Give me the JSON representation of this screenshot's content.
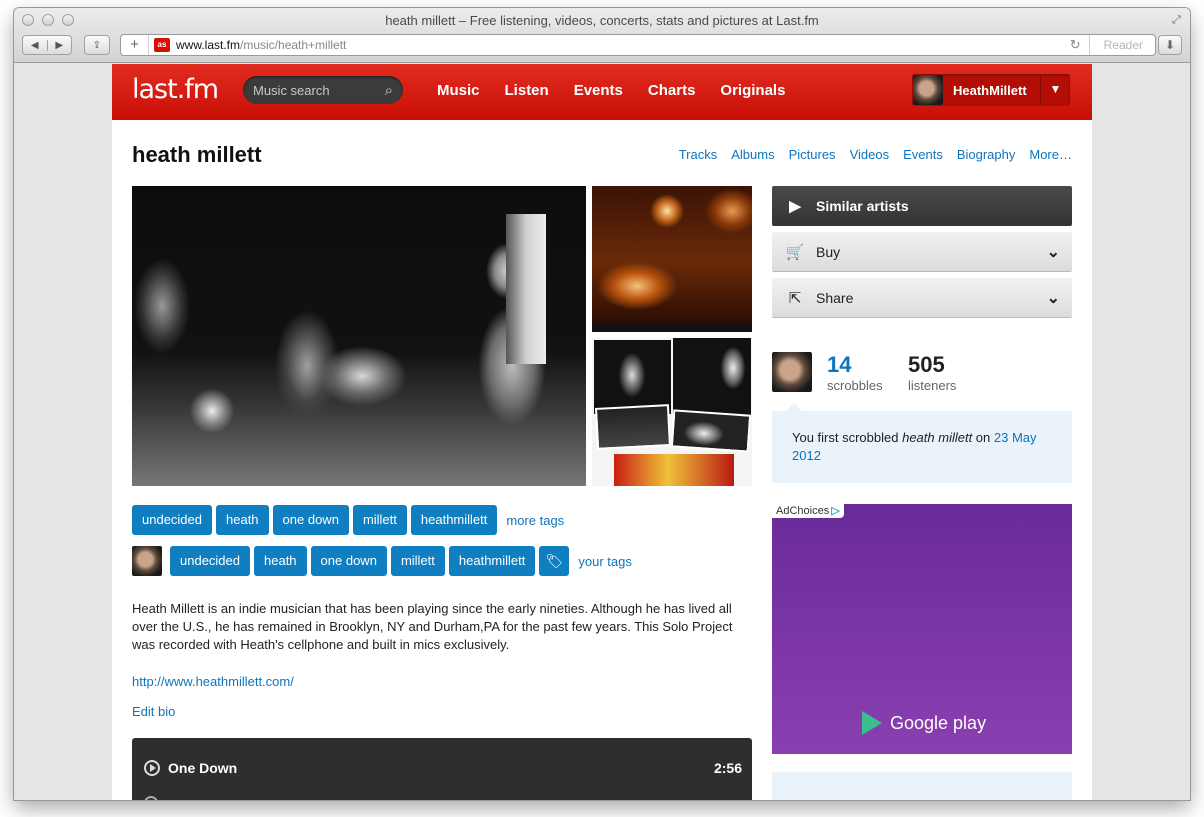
{
  "window": {
    "title": "heath millett – Free listening, videos, concerts, stats and pictures at Last.fm",
    "url_host": "www.last.fm",
    "url_path": "/music/heath+millett",
    "reader_label": "Reader"
  },
  "header": {
    "logo": "last.fm",
    "search_placeholder": "Music search",
    "nav": [
      "Music",
      "Listen",
      "Events",
      "Charts",
      "Originals"
    ],
    "user_name": "HeathMillett"
  },
  "artist": {
    "name": "heath millett",
    "subnav": [
      "Tracks",
      "Albums",
      "Pictures",
      "Videos",
      "Events",
      "Biography",
      "More…"
    ]
  },
  "tags": {
    "top": [
      "undecided",
      "heath",
      "one down",
      "millett",
      "heathmillett"
    ],
    "more_label": "more tags",
    "yours": [
      "undecided",
      "heath",
      "one down",
      "millett",
      "heathmillett"
    ],
    "your_label": "your tags"
  },
  "bio": {
    "text": "Heath Millett is an indie musician that has been playing since the early nineties. Although he has lived all over the U.S., he has remained in Brooklyn, NY and Durham,PA for the past few years. This Solo Project was recorded with Heath's cellphone and built in mics exclusively.",
    "link": "http://www.heathmillett.com/",
    "edit_label": "Edit bio"
  },
  "player": {
    "track": "One Down",
    "duration": "2:56"
  },
  "sidebar": {
    "similar": "Similar artists",
    "buy": "Buy",
    "share": "Share",
    "scrobbles": "14",
    "scrobbles_label": "scrobbles",
    "listeners": "505",
    "listeners_label": "listeners",
    "first_prefix": "You first scrobbled ",
    "first_artist": "heath millett",
    "first_mid": " on ",
    "first_date": "23 May 2012",
    "ad_choices": "AdChoices",
    "ad_brand": "Google play"
  },
  "icons": {
    "search": "search-icon",
    "caret": "chevron-down-icon",
    "play": "play-icon",
    "cart": "cart-icon",
    "share": "share-icon",
    "tag": "tag-icon"
  },
  "colors": {
    "brand_red": "#d51007",
    "link_blue": "#0f74bb",
    "tag_blue": "#0f7fc2"
  }
}
